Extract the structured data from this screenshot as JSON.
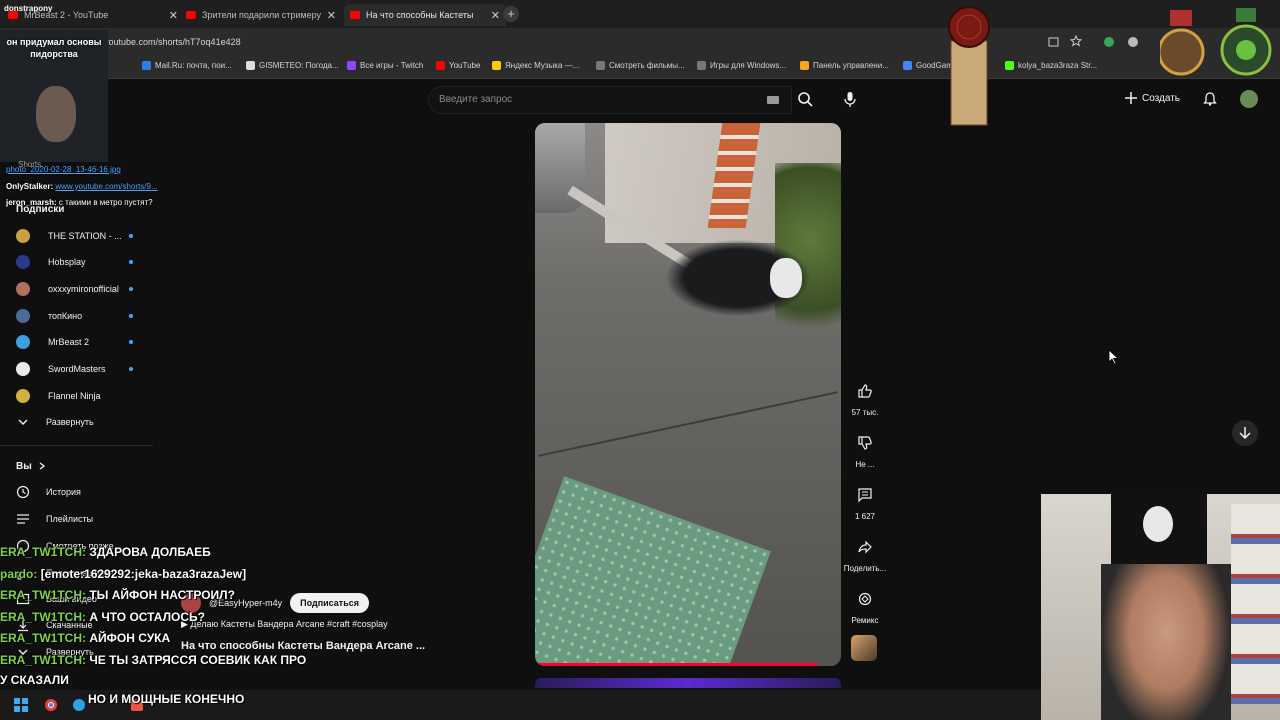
{
  "browser": {
    "tabs": [
      {
        "label": "MrBeast 2 - YouTube"
      },
      {
        "label": "Зрители подарили стримеру"
      },
      {
        "label": "На что способны Кастеты"
      }
    ],
    "url": "youtube.com/shorts/hT7oq41e428",
    "bookmarks": [
      {
        "label": "Mail.Ru: почта, пои..."
      },
      {
        "label": "GISMETEO: Погода..."
      },
      {
        "label": "Все игры - Twitch"
      },
      {
        "label": "YouTube"
      },
      {
        "label": "Яндекс Музыка —..."
      },
      {
        "label": "Смотреть фильмы..."
      },
      {
        "label": "Игры для Windows..."
      },
      {
        "label": "Панель управлени..."
      },
      {
        "label": "GoodGam..."
      },
      {
        "label": "kolya_baza3raza Str..."
      }
    ]
  },
  "header": {
    "search_placeholder": "Введите запрос",
    "create_label": "Создать"
  },
  "sidebar": {
    "shorts_label": "Shorts",
    "subscriptions_title": "Подписки",
    "subscriptions": [
      {
        "name": "THE STATION - ...",
        "color": "#c8a040"
      },
      {
        "name": "Hobsplay",
        "color": "#2a3a8a"
      },
      {
        "name": "oxxxymironofficial",
        "color": "#b07060"
      },
      {
        "name": "топКино",
        "color": "#4a6a9a"
      },
      {
        "name": "MrBeast 2",
        "color": "#3aa0e0"
      },
      {
        "name": "SwordMasters",
        "color": "#eaeaea"
      },
      {
        "name": "Flannel Ninja",
        "color": "#d0b040"
      }
    ],
    "expand_label": "Развернуть",
    "you_title": "Вы",
    "you_items": [
      {
        "label": "История"
      },
      {
        "label": "Плейлисты"
      },
      {
        "label": "Смотреть позже"
      },
      {
        "label": "Понравившиеся"
      },
      {
        "label": "Ваши видео"
      },
      {
        "label": "Скачанные"
      },
      {
        "label": "Развернуть"
      }
    ]
  },
  "short": {
    "progress": 0.92,
    "likes": "57 тыс.",
    "dislike_label": "Не ...",
    "comments": "1 627",
    "share_label": "Поделить...",
    "remix_label": "Ремикс",
    "channel": "@EasyHyper-m4y",
    "subscribe_label": "Подписаться",
    "description": "Делаю Кастеты Вандера Arcane #craft #cosplay",
    "title": "На что способны Кастеты Вандера Arcane ..."
  },
  "stream_overlay": {
    "cam_caption": "он придумал основы пидорства",
    "streamer_tag": "donstrapony",
    "chat_top": [
      {
        "user": "",
        "text": "photo_2020-02-28_13-46-16.jpg",
        "link": true
      },
      {
        "user": "OnlyStalker:",
        "text": "www.youtube.com/shorts/9...",
        "link": true
      },
      {
        "user": "jeron_marsh:",
        "text": "с такими в метро пустят?",
        "link": false
      }
    ],
    "chat_lines": [
      {
        "name": "ERA_TW1TCH:",
        "text": "ЗДАРОВА ДОЛБАЕБ"
      },
      {
        "name": "pardo:",
        "text": "[emote:1629292:jeka-baza3razaJew]"
      },
      {
        "name": "ERA_TW1TCH:",
        "text": "ТЫ АЙФОН НАСТРОИЛ?"
      },
      {
        "name": "ERA_TW1TCH:",
        "text": "А ЧТО ОСТАЛОСЬ?"
      },
      {
        "name": "ERA_TW1TCH:",
        "text": "АЙФОН СУКА"
      },
      {
        "name": "ERA_TW1TCH:",
        "text": "ЧЕ ТЫ ЗАТРЯССЯ СОЕВИК КАК ПРО"
      },
      {
        "name": "",
        "text": "У СКАЗАЛИ"
      },
      {
        "name": "",
        "text": "НО И МОЩНЫЕ КОНЕЧНО"
      }
    ]
  },
  "colors": {
    "accent": "#ff0033",
    "link": "#3ea6ff",
    "chat_name": "#7cd44a"
  }
}
